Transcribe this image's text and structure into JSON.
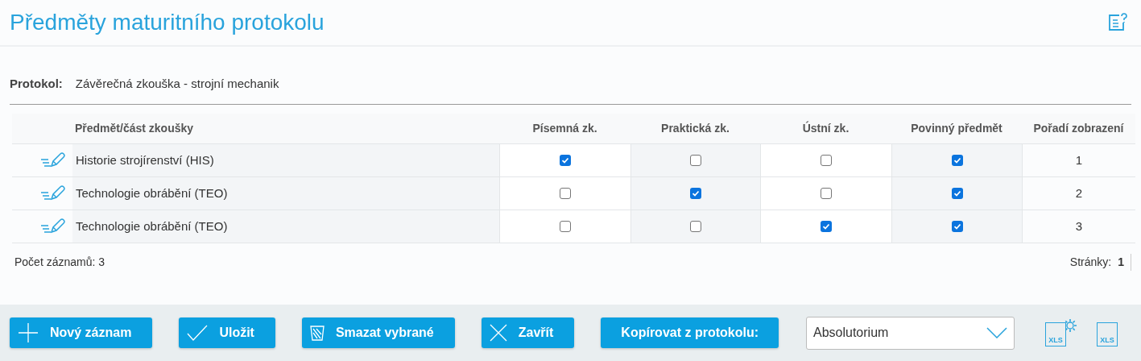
{
  "title": "Předměty maturitního protokolu",
  "protocol": {
    "label": "Protokol:",
    "value": "Závěrečná zkouška - strojní mechanik"
  },
  "table": {
    "columns": [
      "Předmět/část zkoušky",
      "Písemná zk.",
      "Praktická zk.",
      "Ústní zk.",
      "Povinný předmět",
      "Pořadí zobrazení"
    ],
    "rows": [
      {
        "subject": "Historie strojírenství (HIS)",
        "written": true,
        "practical": false,
        "oral": false,
        "mandatory": true,
        "order": "1"
      },
      {
        "subject": "Technologie obrábění (TEO)",
        "written": false,
        "practical": true,
        "oral": false,
        "mandatory": true,
        "order": "2"
      },
      {
        "subject": "Technologie obrábění (TEO)",
        "written": false,
        "practical": false,
        "oral": true,
        "mandatory": true,
        "order": "3"
      }
    ]
  },
  "footer": {
    "record_count": "Počet záznamů: 3",
    "pages_label": "Stránky:",
    "page": "1"
  },
  "buttons": [
    {
      "kind": "add",
      "label": "Nový záznam"
    },
    {
      "kind": "save",
      "label": "Uložit"
    },
    {
      "kind": "delete",
      "label": "Smazat vybrané"
    },
    {
      "kind": "close",
      "label": "Zavřít"
    },
    {
      "kind": "copy",
      "label": "Kopírovat z protokolu:"
    }
  ],
  "select": {
    "value": "Absolutorium"
  },
  "exports": [
    {
      "kind": "settings",
      "label": "XLS"
    },
    {
      "kind": "plain",
      "label": "XLS"
    }
  ]
}
